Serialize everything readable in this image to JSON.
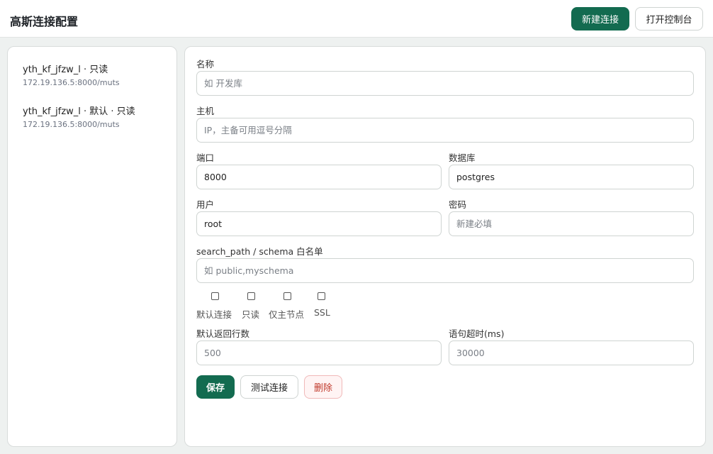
{
  "header": {
    "title": "高斯连接配置",
    "new_connection": "新建连接",
    "open_console": "打开控制台"
  },
  "connections": [
    {
      "name": "yth_kf_jfzw_l · 只读",
      "address": "172.19.136.5:8000/muts"
    },
    {
      "name": "yth_kf_jfzw_l · 默认 · 只读",
      "address": "172.19.136.5:8000/muts"
    }
  ],
  "form": {
    "name": {
      "label": "名称",
      "placeholder": "如 开发库"
    },
    "host": {
      "label": "主机",
      "placeholder": "IP，主备可用逗号分隔"
    },
    "port": {
      "label": "端口",
      "value": "8000"
    },
    "database": {
      "label": "数据库",
      "value": "postgres"
    },
    "user": {
      "label": "用户",
      "value": "root"
    },
    "password": {
      "label": "密码",
      "placeholder": "新建必填"
    },
    "search_path": {
      "label": "search_path / schema 白名单",
      "placeholder": "如 public,myschema"
    },
    "checkboxes": [
      {
        "label": "默认连接",
        "checked": false
      },
      {
        "label": "只读",
        "checked": false
      },
      {
        "label": "仅主节点",
        "checked": false
      },
      {
        "label": "SSL",
        "checked": false
      }
    ],
    "default_rows": {
      "label": "默认返回行数",
      "placeholder": "500"
    },
    "statement_timeout": {
      "label": "语句超时(ms)",
      "placeholder": "30000"
    }
  },
  "actions": {
    "save": "保存",
    "test": "测试连接",
    "delete": "删除"
  }
}
